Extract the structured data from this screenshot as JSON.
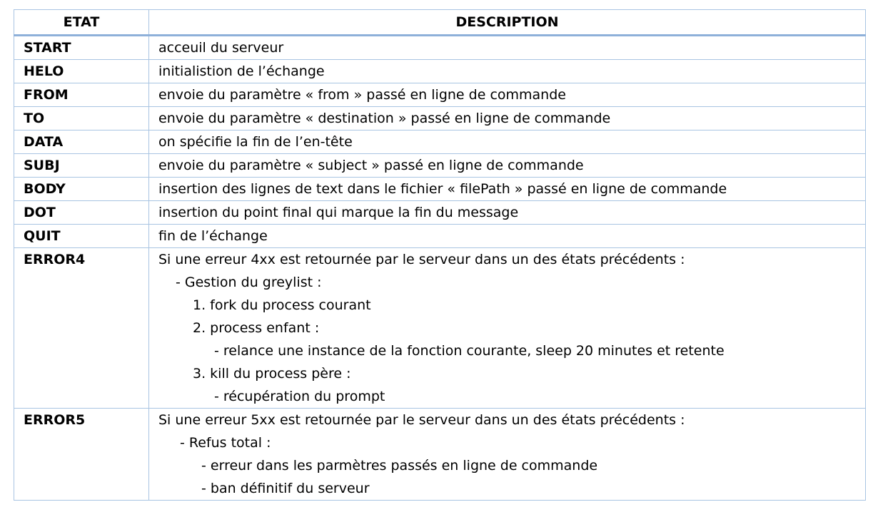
{
  "table": {
    "headers": {
      "state": "ETAT",
      "description": "DESCRIPTION"
    },
    "rows": [
      {
        "state": "START",
        "description": "acceuil du serveur"
      },
      {
        "state": "HELO",
        "description": "initialistion de l’échange"
      },
      {
        "state": "FROM",
        "description": "envoie du paramètre « from » passé en ligne de commande"
      },
      {
        "state": "TO",
        "description": "envoie du paramètre « destination » passé en ligne de commande"
      },
      {
        "state": "DATA",
        "description": "on spécifie la fin de l’en-tête"
      },
      {
        "state": "SUBJ",
        "description": "envoie du paramètre « subject » passé en ligne de commande"
      },
      {
        "state": "BODY",
        "description": "insertion des lignes de text dans le fichier « filePath » passé en ligne de commande"
      },
      {
        "state": "DOT",
        "description": "insertion du point final qui marque la fin du message"
      },
      {
        "state": "QUIT",
        "description": "fin de l’échange"
      }
    ],
    "error4": {
      "state": "ERROR4",
      "lines": [
        "Si une erreur 4xx est retournée par le serveur dans un des états précédents :",
        "- Gestion du greylist :",
        "1. fork du process courant",
        "2. process enfant :",
        "- relance une instance de la fonction courante, sleep 20 minutes et retente",
        "3. kill du process père :",
        "- récupération du prompt"
      ]
    },
    "error5": {
      "state": "ERROR5",
      "lines": [
        "Si une erreur 5xx est retournée par le serveur dans un des états précédents :",
        "- Refus total :",
        "- erreur dans les parmètres passés en ligne de commande",
        "- ban définitif du serveur"
      ]
    }
  }
}
